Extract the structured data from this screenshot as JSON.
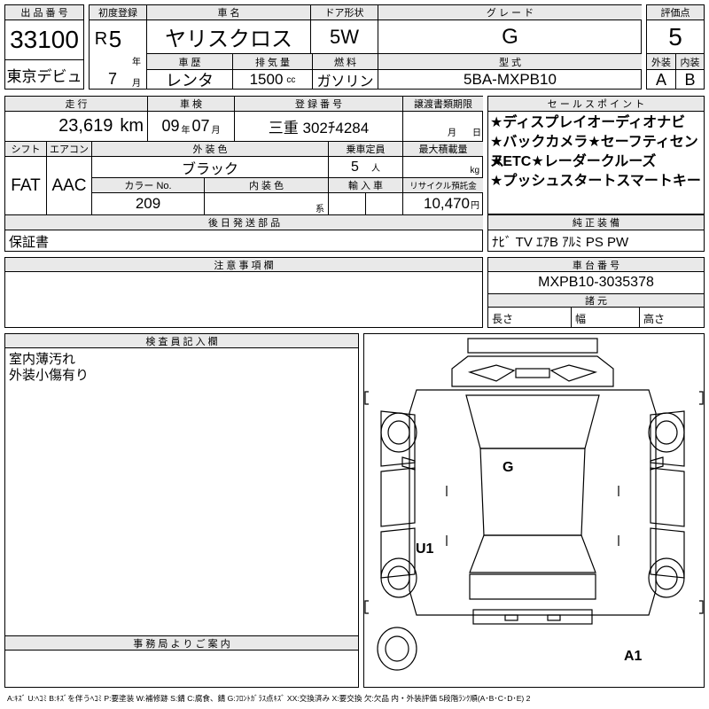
{
  "header": {
    "lot_label": "出 品 番 号",
    "lot_number": "33100",
    "venue": "東京デビュ",
    "first_reg_label": "初度登録",
    "era": "R",
    "year_value": "5",
    "year_unit": "年",
    "month_value": "7",
    "month_unit": "月",
    "name_label": "車 名",
    "name_value": "ヤリスクロス",
    "door_label": "ドア形状",
    "door_value": "5W",
    "grade_label": "グ レ ー ド",
    "grade_value": "G",
    "score_label": "評価点",
    "score_value": "5",
    "history_label": "車 歴",
    "history_value": "レンタ",
    "displacement_label": "排 気 量",
    "displacement_value": "1500",
    "displacement_unit": "cc",
    "fuel_label": "燃 料",
    "fuel_value": "ガソリン",
    "model_label": "型 式",
    "model_value": "5BA-MXPB10",
    "exterior_grade_label": "外装",
    "exterior_grade_value": "A",
    "interior_grade_label": "内装",
    "interior_grade_value": "B"
  },
  "details": {
    "mileage_label": "走 行",
    "mileage_value": "23,619",
    "mileage_unit": "km",
    "inspection_label": "車 検",
    "inspection_year": "09",
    "inspection_year_unit": "年",
    "inspection_month": "07",
    "inspection_month_unit": "月",
    "plate_label": "登 録 番 号",
    "plate_value": "三重 302ﾁ4284",
    "transfer_label": "譲渡書類期限",
    "transfer_month_unit": "月",
    "transfer_day_unit": "日",
    "shift_label": "シフト",
    "shift_value": "FAT",
    "ac_label": "エアコン",
    "ac_value": "AAC",
    "color_label": "外 装 色",
    "color_value": "ブラック",
    "capacity_label": "乗車定員",
    "capacity_value": "5",
    "capacity_unit": "人",
    "load_label": "最大積載量",
    "load_unit": "kg",
    "color_no_label": "カラー No.",
    "color_no_value": "209",
    "interior_color_label": "内 装 色",
    "interior_color_unit": "系",
    "import_label": "輸 入 車",
    "recycle_label": "リサイクル預託金",
    "recycle_value": "10,470",
    "recycle_unit": "円"
  },
  "sales_points": {
    "label": "セ ー ル ス ポ イ ン ト",
    "items": [
      "★ディスプレイオーディオナビ",
      "★バックカメラ★セーフティセンス",
      "★ETC★レーダークルーズ",
      "★プッシュスタートスマートキー"
    ]
  },
  "accessories": {
    "label": "後 日 発 送 部 品",
    "value": "保証書"
  },
  "equipment": {
    "label": "純 正 装 備",
    "value": "ﾅﾋﾞ TV ｴｱB ｱﾙﾐ PS PW"
  },
  "notes": {
    "label": "注 意 事 項 欄"
  },
  "chassis": {
    "label": "車 台 番 号",
    "value": "MXPB10-3035378",
    "dims_label": "諸 元",
    "length_label": "長さ",
    "width_label": "幅",
    "height_label": "高さ"
  },
  "inspector": {
    "label": "検 査 員 記 入 欄",
    "lines": [
      "室内薄汚れ",
      "外装小傷有り"
    ]
  },
  "office": {
    "label": "事 務 局 よ り ご 案 内"
  },
  "diagram": {
    "marks": {
      "roof": "G",
      "side": "U1",
      "rear": "A1"
    }
  },
  "legend": "A:ｷｽﾞ U:ﾍｺﾐ B:ｷｽﾞを伴うﾍｺﾐ P:要塗装 W:補修跡 S:錆 C:腐食、錆 G:ﾌﾛﾝﾄｶﾞﾗｽ点ｷｽﾞ XX:交換済み X:要交換 欠:欠品 内・外装評価 5段階ﾗﾝｸ順(A･B･C･D･E) 2"
}
